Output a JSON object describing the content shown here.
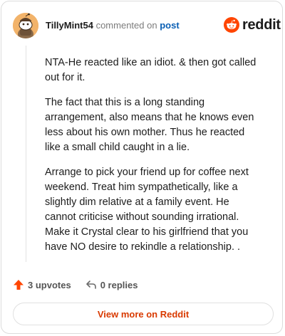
{
  "comment": {
    "username": "TillyMint54",
    "commented_on_text": "commented on",
    "post_link": "post",
    "avatar_icon": "snoo-avatar-icon",
    "paragraphs": [
      "NTA-He reacted like an idiot. & then got called out for it.",
      "The fact that this is a long standing arrangement, also means that he knows even less about his own mother. Thus he reacted like a small child caught in a lie.",
      "Arrange to pick your friend up for coffee next weekend. Treat him sympathetically, like a slightly dim relative at a family event. He cannot criticise without sounding irrational. Make it Crystal clear to his girlfriend that you have NO desire to rekindle a relationship. ."
    ]
  },
  "brand": {
    "name": "reddit",
    "icon": "reddit-logo-icon",
    "color": "#ff4500"
  },
  "actions": {
    "upvotes": "3 upvotes",
    "upvote_icon": "upvote-arrow-icon",
    "upvote_color": "#ff4500",
    "replies": "0 replies",
    "reply_icon": "reply-arrow-icon"
  },
  "footer": {
    "view_more_label": "View more on Reddit",
    "link_color": "#d93a00"
  }
}
